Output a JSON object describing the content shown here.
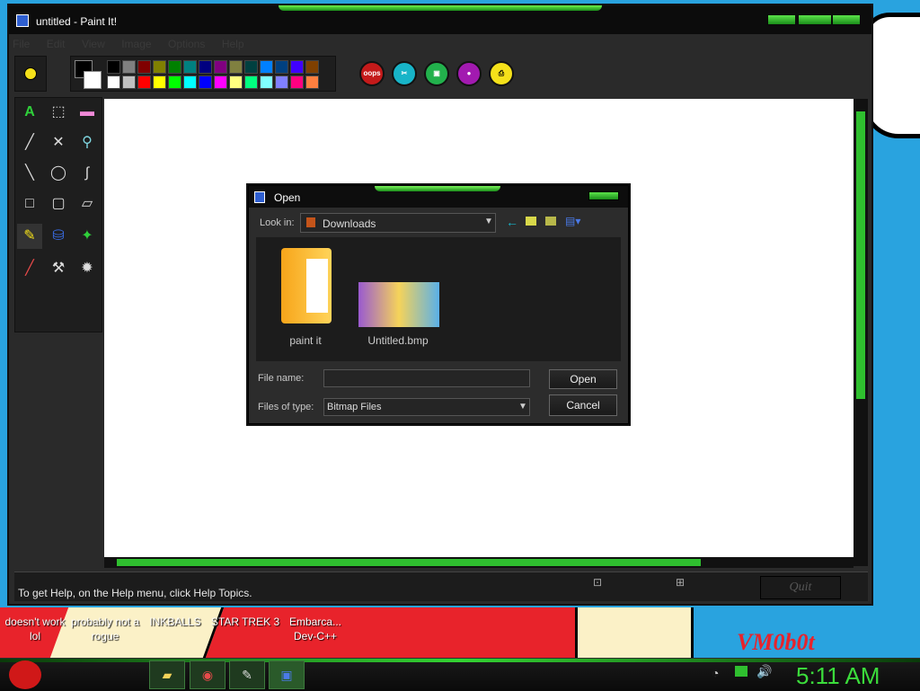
{
  "window": {
    "title": "untitled - Paint It!"
  },
  "menu": [
    "File",
    "Edit",
    "View",
    "Image",
    "Options",
    "Help"
  ],
  "action_buttons": [
    {
      "label": "oops",
      "icon": "undo-icon",
      "color": "#c41a1a"
    },
    {
      "label": "",
      "icon": "scissors-icon",
      "color": "#18b4c8"
    },
    {
      "label": "",
      "icon": "camera-icon",
      "color": "#22b14c"
    },
    {
      "label": "",
      "icon": "bottle-icon",
      "color": "#a21ab0"
    },
    {
      "label": "",
      "icon": "printer-icon",
      "color": "#f5e11a"
    }
  ],
  "status": {
    "text": "To get Help, on the Help menu, click Help Topics.",
    "quit": "Quit"
  },
  "dialog": {
    "title": "Open",
    "look_in_label": "Look in:",
    "look_in_value": "Downloads",
    "items": [
      {
        "name": "paint it",
        "icon": "folder-icon"
      },
      {
        "name": "Untitled.bmp",
        "icon": "bitmap-thumbnail"
      }
    ],
    "file_name_label": "File name:",
    "file_name_value": "",
    "file_type_label": "Files of type:",
    "file_type_value": "Bitmap Files",
    "open_button": "Open",
    "cancel_button": "Cancel"
  },
  "desktop_icons": [
    {
      "label": "doesn't work lol"
    },
    {
      "label": "probably not a rogue"
    },
    {
      "label": "INKBALLS"
    },
    {
      "label": "STAR TREK 3"
    },
    {
      "label": "Embarca... Dev-C++"
    }
  ],
  "signature": "VM0b0t",
  "taskbar": {
    "clock": "5:11 AM"
  }
}
